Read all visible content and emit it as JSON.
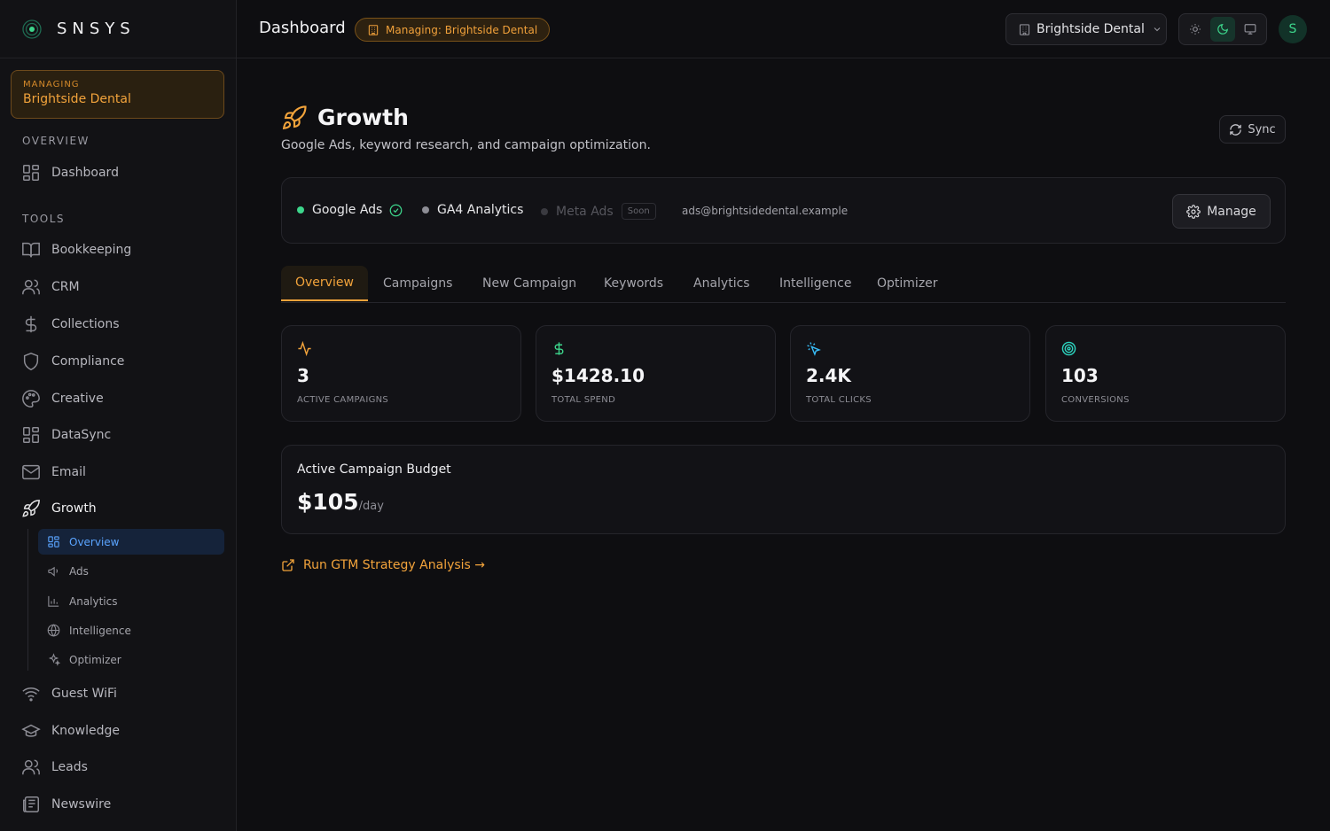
{
  "brand": {
    "name": "SNSYS"
  },
  "managing": {
    "kicker": "MANAGING",
    "name": "Brightside Dental"
  },
  "sidebar": {
    "overview_label": "OVERVIEW",
    "tools_label": "TOOLS",
    "dashboard": "Dashboard",
    "tools": [
      {
        "label": "Bookkeeping",
        "icon": "book-icon"
      },
      {
        "label": "CRM",
        "icon": "users-icon"
      },
      {
        "label": "Collections",
        "icon": "dollar-icon"
      },
      {
        "label": "Compliance",
        "icon": "shield-icon"
      },
      {
        "label": "Creative",
        "icon": "palette-icon"
      },
      {
        "label": "DataSync",
        "icon": "grid-icon"
      },
      {
        "label": "Email",
        "icon": "mail-icon"
      },
      {
        "label": "Growth",
        "icon": "rocket-icon"
      }
    ],
    "growth_sub": [
      {
        "label": "Overview",
        "icon": "grid-icon"
      },
      {
        "label": "Ads",
        "icon": "megaphone-icon"
      },
      {
        "label": "Analytics",
        "icon": "bar-chart-icon"
      },
      {
        "label": "Intelligence",
        "icon": "globe-icon"
      },
      {
        "label": "Optimizer",
        "icon": "sparkles-icon"
      }
    ],
    "more_tools": [
      {
        "label": "Guest WiFi",
        "icon": "wifi-icon"
      },
      {
        "label": "Knowledge",
        "icon": "graduation-cap-icon"
      },
      {
        "label": "Leads",
        "icon": "users-icon"
      },
      {
        "label": "Newswire",
        "icon": "newspaper-icon"
      }
    ]
  },
  "topbar": {
    "title": "Dashboard",
    "badge": "Managing: Brightside Dental",
    "org": "Brightside Dental",
    "avatar_initial": "S",
    "theme_selected": "dark"
  },
  "page": {
    "title": "Growth",
    "subtitle": "Google Ads, keyword research, and campaign optimization.",
    "sync_label": "Sync"
  },
  "connections": {
    "google_ads": "Google Ads",
    "ga4": "GA4 Analytics",
    "meta": "Meta Ads",
    "soon": "Soon",
    "email": "ads@brightsidedental.example",
    "manage_label": "Manage"
  },
  "tabs": [
    "Overview",
    "Campaigns",
    "New Campaign",
    "Keywords",
    "Analytics",
    "Intelligence",
    "Optimizer"
  ],
  "stats": [
    {
      "value": "3",
      "label": "ACTIVE CAMPAIGNS",
      "icon": "activity-icon",
      "color": "#f2a33b"
    },
    {
      "value": "$1428.10",
      "label": "TOTAL SPEND",
      "icon": "dollar-icon",
      "color": "#3dd68c"
    },
    {
      "value": "2.4K",
      "label": "TOTAL CLICKS",
      "icon": "cursor-click-icon",
      "color": "#38bdf8"
    },
    {
      "value": "103",
      "label": "CONVERSIONS",
      "icon": "target-icon",
      "color": "#2dd4bf"
    }
  ],
  "budget": {
    "title": "Active Campaign Budget",
    "amount": "$105",
    "per": "/day"
  },
  "gtm_link": "Run GTM Strategy Analysis →",
  "colors": {
    "accent": "#f2a33b",
    "success": "#3dd68c",
    "link_blue": "#5aa4ff"
  }
}
